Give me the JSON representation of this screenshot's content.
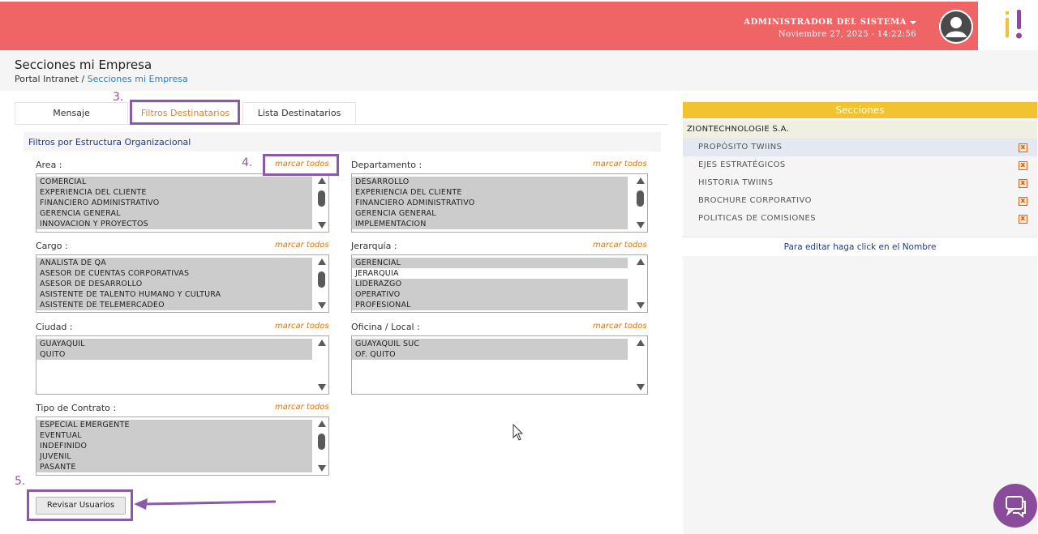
{
  "header": {
    "user_name": "ADMINISTRADOR DEL SISTEMA",
    "datetime": "Noviembre 27, 2025 -  14:22:56",
    "accent_color": "#ef6464"
  },
  "page": {
    "title": "Secciones mi Empresa",
    "breadcrumb_root": "Portal Intranet",
    "breadcrumb_separator": " / ",
    "breadcrumb_current": "Secciones mi Empresa"
  },
  "tabs": [
    {
      "label": "Mensaje",
      "active": false
    },
    {
      "label": "Filtros Destinatarios",
      "active": true
    },
    {
      "label": "Lista Destinatarios",
      "active": false
    }
  ],
  "filter_section_title": "Filtros por Estructura Organizacional",
  "marcar_label": "marcar todos",
  "filters": {
    "area": {
      "label": "Area :",
      "options": [
        "COMERCIAL",
        "EXPERIENCIA DEL CLIENTE",
        "FINANCIERO ADMINISTRATIVO",
        "GERENCIA GENERAL",
        "INNOVACION Y PROYECTOS"
      ]
    },
    "departamento": {
      "label": "Departamento :",
      "options": [
        "DESARROLLO",
        "EXPERIENCIA DEL CLIENTE",
        "FINANCIERO ADMINISTRATIVO",
        "GERENCIA GENERAL",
        "IMPLEMENTACION"
      ]
    },
    "cargo": {
      "label": "Cargo :",
      "options": [
        "ANALISTA DE QA",
        "ASESOR DE CUENTAS CORPORATIVAS",
        "ASESOR DE DESARROLLO",
        "ASISTENTE DE TALENTO HUMANO Y CULTURA",
        "ASISTENTE DE TELEMERCADEO"
      ]
    },
    "jerarquia": {
      "label": "Jerarquía :",
      "options": [
        "GERENCIAL",
        "JERARQUIA",
        "LIDERAZGO",
        "OPERATIVO",
        "PROFESIONAL"
      ]
    },
    "ciudad": {
      "label": "Ciudad :",
      "options": [
        "GUAYAQUIL",
        "QUITO"
      ]
    },
    "oficina": {
      "label": "Oficina / Local :",
      "options": [
        "GUAYAQUIL SUC",
        "OF. QUITO"
      ]
    },
    "contrato": {
      "label": "Tipo de Contrato :",
      "options": [
        "ESPECIAL EMERGENTE",
        "EVENTUAL",
        "INDEFINIDO",
        "JUVENIL",
        "PASANTE"
      ]
    }
  },
  "revisar_button": "Revisar Usuarios",
  "annotations": [
    "3.",
    "4.",
    "5."
  ],
  "secciones": {
    "header": "Secciones",
    "header_color": "#f2c331",
    "company": "ZIONTECHNOLOGIE S.A.",
    "items": [
      "PROPÓSITO TWIINS",
      "EJES ESTRATÉGICOS",
      "HISTORIA TWIINS",
      "BROCHURE CORPORATIVO",
      "POLITICAS DE COMISIONES"
    ],
    "delete_glyph": "x",
    "footer": "Para editar haga click en el Nombre"
  },
  "annotation_color": "#8a5aa6"
}
